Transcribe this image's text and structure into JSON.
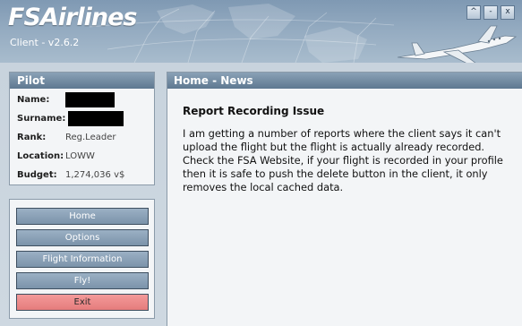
{
  "header": {
    "brand": "FSAirlines",
    "version": "Client - v2.6.2",
    "window_controls": [
      "^",
      "-",
      "x"
    ]
  },
  "pilot": {
    "title": "Pilot",
    "name_label": "Name:",
    "name_value_redacted": true,
    "surname_label": "Surname:",
    "surname_value_redacted": true,
    "rank_label": "Rank:",
    "rank_value": "Reg.Leader",
    "location_label": "Location:",
    "location_value": "LOWW",
    "budget_label": "Budget:",
    "budget_value": "1,274,036 v$"
  },
  "nav": {
    "items": [
      "Home",
      "Options",
      "Flight Information",
      "Fly!",
      "Exit"
    ]
  },
  "news": {
    "title": "Home - News",
    "heading": "Report Recording Issue",
    "body": "I am getting a number of reports where the client says it can't upload the flight but the flight is actually already recorded. Check the FSA Website, if your flight is recorded in your profile then it is safe to push the delete button in the client, it only removes the local cached data."
  },
  "colors": {
    "panel_header": "#6f89a2",
    "nav_button": "#8aa0b6",
    "exit_button": "#ec8888"
  }
}
